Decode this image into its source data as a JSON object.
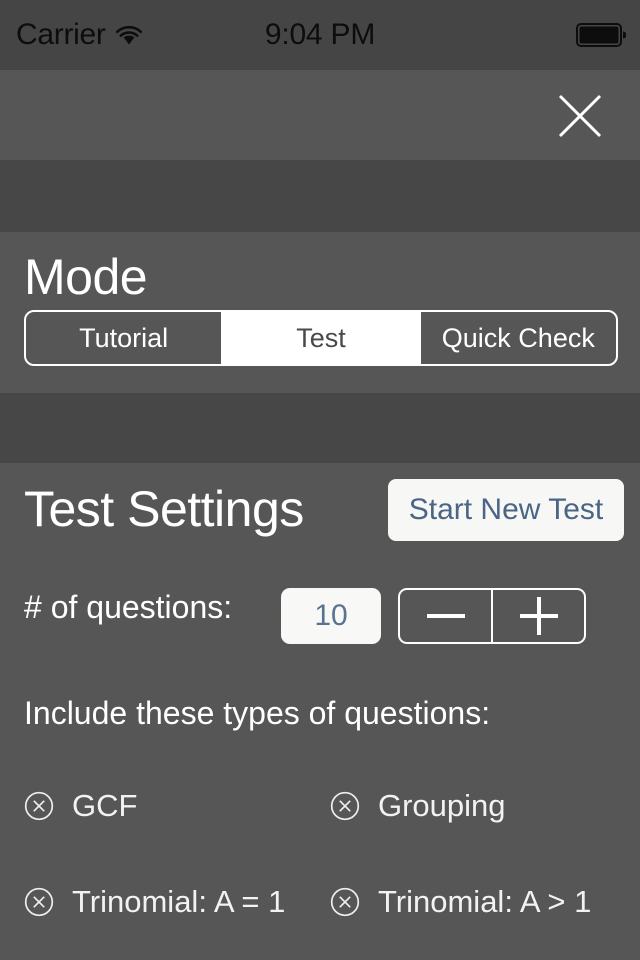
{
  "status_bar": {
    "carrier": "Carrier",
    "wifi_icon": "wifi-icon",
    "time": "9:04 PM",
    "battery_icon": "battery-full-icon"
  },
  "header": {
    "close_icon": "close-x-icon"
  },
  "mode_section": {
    "title": "Mode",
    "segments": [
      {
        "label": "Tutorial",
        "selected": false
      },
      {
        "label": "Test",
        "selected": true
      },
      {
        "label": "Quick Check",
        "selected": false
      }
    ]
  },
  "settings_section": {
    "title": "Test Settings",
    "start_new_test_label": "Start New Test",
    "questions_label": "# of questions:",
    "questions_value": "10",
    "stepper": {
      "decrement_icon": "minus-icon",
      "increment_icon": "plus-icon"
    },
    "include_label": "Include these types of questions:",
    "question_types": [
      {
        "label": "GCF",
        "checked": true,
        "icon": "circle-x-icon"
      },
      {
        "label": "Grouping",
        "checked": true,
        "icon": "circle-x-icon"
      },
      {
        "label": "Trinomial: A = 1",
        "checked": true,
        "icon": "circle-x-icon"
      },
      {
        "label": "Trinomial: A > 1",
        "checked": true,
        "icon": "circle-x-icon"
      }
    ]
  },
  "colors": {
    "background": "#565656",
    "band_dark": "#474747",
    "status_bar": "#454545",
    "accent_blue": "#4a6585",
    "value_blue": "#5a7391",
    "text_white": "#ffffff",
    "selected_segment_bg": "#ffffff",
    "selected_segment_text": "#4a4a4a",
    "button_bg": "#f7f7f5"
  }
}
